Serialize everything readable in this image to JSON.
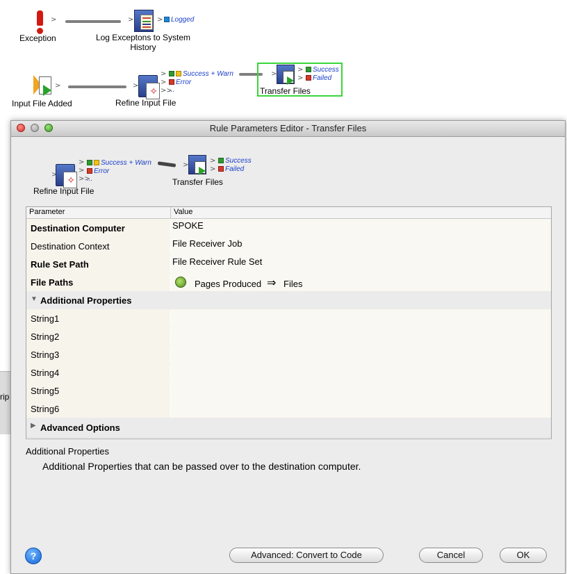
{
  "background_workflow": {
    "nodes": {
      "exception": {
        "label": "Exception"
      },
      "log": {
        "label": "Log Exceptons to System\nHistory",
        "output": "Logged"
      },
      "input_file_added": {
        "label": "Input File Added"
      },
      "refine_input_file": {
        "label": "Refine Input File",
        "outputs": [
          "Success + Warn",
          "Error",
          "..."
        ]
      },
      "transfer_files": {
        "label": "Transfer Files",
        "outputs": [
          "Success",
          "Failed"
        ]
      }
    }
  },
  "left_edge_text": "rip",
  "dialog": {
    "title": "Rule Parameters Editor - Transfer Files",
    "preview": {
      "refine_label": "Refine Input File",
      "refine_outputs": [
        "Success + Warn",
        "Error",
        "..."
      ],
      "transfer_label": "Transfer Files",
      "transfer_outputs": [
        "Success",
        "Failed"
      ]
    },
    "table": {
      "headers": {
        "parameter": "Parameter",
        "value": "Value"
      },
      "rows": [
        {
          "name": "Destination Computer",
          "value": "SPOKE"
        },
        {
          "name": "Destination Context",
          "value": "File Receiver Job"
        },
        {
          "name": "Rule Set Path",
          "value": "File Receiver Rule Set"
        },
        {
          "name": "File Paths",
          "value_part1": "Pages Produced",
          "value_part2": "Files"
        }
      ],
      "group_additional": "Additional Properties",
      "strings": [
        "String1",
        "String2",
        "String3",
        "String4",
        "String5",
        "String6"
      ],
      "group_advanced": "Advanced Options"
    },
    "description": {
      "title": "Additional Properties",
      "text": "Additional Properties that can be passed over to the destination computer."
    },
    "buttons": {
      "help": "?",
      "convert": "Advanced: Convert to Code",
      "cancel": "Cancel",
      "ok": "OK"
    }
  }
}
